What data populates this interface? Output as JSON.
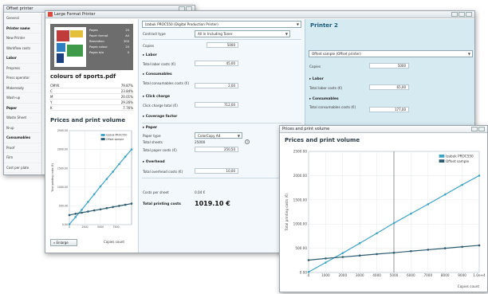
{
  "back_window": {
    "title": "Offset printer",
    "sidebar": [
      {
        "label": "General",
        "bold": false
      },
      {
        "label": "Printer name",
        "bold": true
      },
      {
        "label": "New Printer",
        "bold": false
      },
      {
        "label": "Workflow costs",
        "bold": false
      },
      {
        "label": "Labor",
        "bold": true
      },
      {
        "label": "Prepress",
        "bold": false
      },
      {
        "label": "Press operator",
        "bold": false
      },
      {
        "label": "Makeready",
        "bold": false
      },
      {
        "label": "Wash-up",
        "bold": false
      },
      {
        "label": "Paper",
        "bold": true
      },
      {
        "label": "Waste Sheet",
        "bold": false
      },
      {
        "label": "N-up",
        "bold": false
      },
      {
        "label": "Consumables",
        "bold": true
      },
      {
        "label": "Proof",
        "bold": false
      },
      {
        "label": "Film",
        "bold": false
      },
      {
        "label": "Cost per plate",
        "bold": false
      },
      {
        "label": "Ink",
        "bold": false
      },
      {
        "label": "Overhead",
        "bold": true
      },
      {
        "label": "Monthly costs",
        "bold": false
      }
    ]
  },
  "main_window": {
    "title": "Large Format Printer",
    "document": {
      "meta": [
        {
          "k": "Pages",
          "v": "20"
        },
        {
          "k": "Paper format",
          "v": "A4"
        },
        {
          "k": "Resolution",
          "v": "300"
        },
        {
          "k": "Pages colour",
          "v": "20"
        },
        {
          "k": "Pages b/w",
          "v": "0"
        }
      ],
      "title": "colours of sports.pdf",
      "colors": [
        {
          "name": "CMYK",
          "value": "79.87%"
        },
        {
          "name": "C",
          "value": "23.84%"
        },
        {
          "name": "M",
          "value": "20.01%"
        },
        {
          "name": "Y",
          "value": "29.26%"
        },
        {
          "name": "K",
          "value": "7.76%"
        }
      ]
    },
    "small_chart": {
      "title": "Prices and print volume",
      "legend": [
        "Izabuk PROC550",
        "Offset sample"
      ],
      "yticks": [
        "2500.00",
        "2000.00",
        "1500.00",
        "1000.00",
        "500.00",
        "0.00"
      ],
      "xticks": [
        "0",
        "2500",
        "5000",
        "7500"
      ],
      "ylabel": "Total printing costs (€)",
      "xlabel": "Copies count",
      "enlarge_label": "Enlarge"
    },
    "printer1": {
      "selector": "Izabuk PROC550 (Digital Production Printer)",
      "contract_type_label": "Contract type",
      "contract_type": "All In Including Toner",
      "copies_label": "Copies",
      "copies": "5000",
      "labor_section": "Labor",
      "total_labor_label": "Total labor costs (€)",
      "total_labor": "45,00",
      "consumables_section": "Consumables",
      "total_consumables_label": "Total consumables costs (€)",
      "total_consumables": "2,00",
      "click_section": "Click charge",
      "click_total_label": "Click charge total (€)",
      "click_total": "712,00",
      "coverage_section": "Coverage factor",
      "paper_section": "Paper",
      "paper_type_label": "Paper type",
      "paper_type": "ColorCopy A4",
      "total_sheets_label": "Total sheets",
      "total_sheets": "25000",
      "total_paper_label": "Total paper costs (€)",
      "total_paper": "250,50",
      "overhead_section": "Overhead",
      "total_overhead_label": "Total overhead costs (€)",
      "total_overhead": "10,00",
      "cost_per_sheet_label": "Costs per sheet",
      "cost_per_sheet": "0.04 €",
      "total_printing_label": "Total printing costs",
      "total_printing": "1019.10 €"
    },
    "printer2": {
      "title": "Printer 2",
      "selector": "Offset sample (Offset printer)",
      "copies_label": "Copies",
      "copies": "5000",
      "labor_section": "Labor",
      "total_labor_label": "Total labor costs (€)",
      "total_labor": "65,00",
      "consumables_section": "Consumables",
      "total_consumables_label": "Total consumables costs (€)",
      "total_consumables": "177,00"
    }
  },
  "chart_window": {
    "title": "Prices and print volume",
    "colors": {
      "izabuk": "#3da3c4",
      "offset": "#2c5a6f"
    },
    "chart_data": {
      "type": "line",
      "title": "Prices and print volume",
      "xlabel": "Copies count",
      "ylabel": "Total printing costs (€)",
      "xlim": [
        0,
        10000
      ],
      "ylim": [
        0,
        2500
      ],
      "yticks": [
        "2500.00",
        "2000.00",
        "1500.00",
        "1000.00",
        "500.00",
        "0.00"
      ],
      "xticks": [
        "0",
        "1000",
        "2000",
        "3000",
        "4000",
        "5000",
        "6000",
        "7000",
        "8000",
        "9000",
        "1.0e+4"
      ],
      "grid": true,
      "legend": "top-right",
      "marker_x": 5000,
      "series": [
        {
          "name": "Izabuk PROC550",
          "x": [
            0,
            1000,
            2000,
            3000,
            4000,
            5000,
            6000,
            7000,
            8000,
            9000,
            10000
          ],
          "y": [
            10,
            205,
            400,
            605,
            810,
            1019,
            1215,
            1410,
            1610,
            1810,
            2000
          ]
        },
        {
          "name": "Offset sample",
          "x": [
            0,
            1000,
            2000,
            3000,
            4000,
            5000,
            6000,
            7000,
            8000,
            9000,
            10000
          ],
          "y": [
            255,
            290,
            320,
            350,
            380,
            408,
            440,
            470,
            500,
            530,
            560
          ]
        }
      ]
    }
  }
}
